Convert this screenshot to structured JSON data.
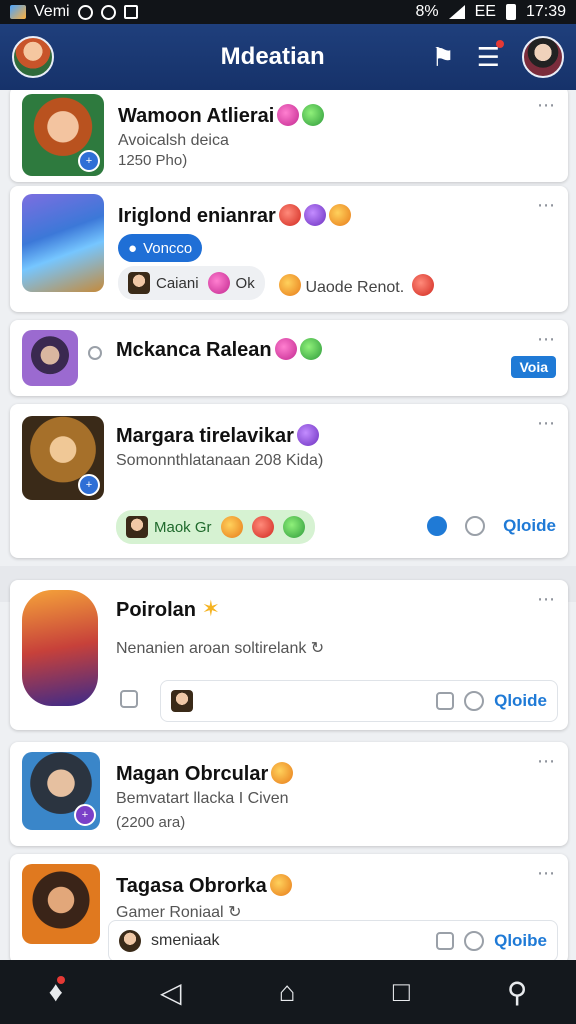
{
  "status": {
    "carrier": "Vemi",
    "network": "EE",
    "time": "17:39",
    "signal": "8%"
  },
  "app": {
    "title": "Mdeatian"
  },
  "cards": [
    {
      "title": "Wamoon Atlierai",
      "subtitle": "Avoicalsh deica",
      "meta": "1250 Pho)"
    },
    {
      "title": "Iriglond enianrar",
      "pill": "Voncco",
      "chip_left": "Caiani",
      "chip_count": "Ok",
      "chip_right": "Uaode Renot."
    },
    {
      "title": "Mckanca Ralean",
      "button": "Voia"
    },
    {
      "title": "Margara tirelavikar",
      "subtitle": "Somonnthlatanaan 208 Kida)",
      "chip": "Maok Gr",
      "action": "Qloide"
    },
    {
      "title": "Poirolan",
      "subtitle": "Nenanien aroan soltirelank",
      "action": "Qloide"
    },
    {
      "title": "Magan Obrcular",
      "subtitle": "Bemvatart llacka I Civen",
      "meta": "(2200 ara)"
    },
    {
      "title": "Tagasa Obrorka",
      "subtitle": "Gamer Roniaal",
      "reply_text": "smeniaak",
      "action": "Qloibe"
    }
  ],
  "icons": {
    "app_avatar": "hero-avatar-icon",
    "notify": "notification-bell-icon",
    "menu": "menu-list-icon",
    "user": "user-avatar-icon"
  }
}
